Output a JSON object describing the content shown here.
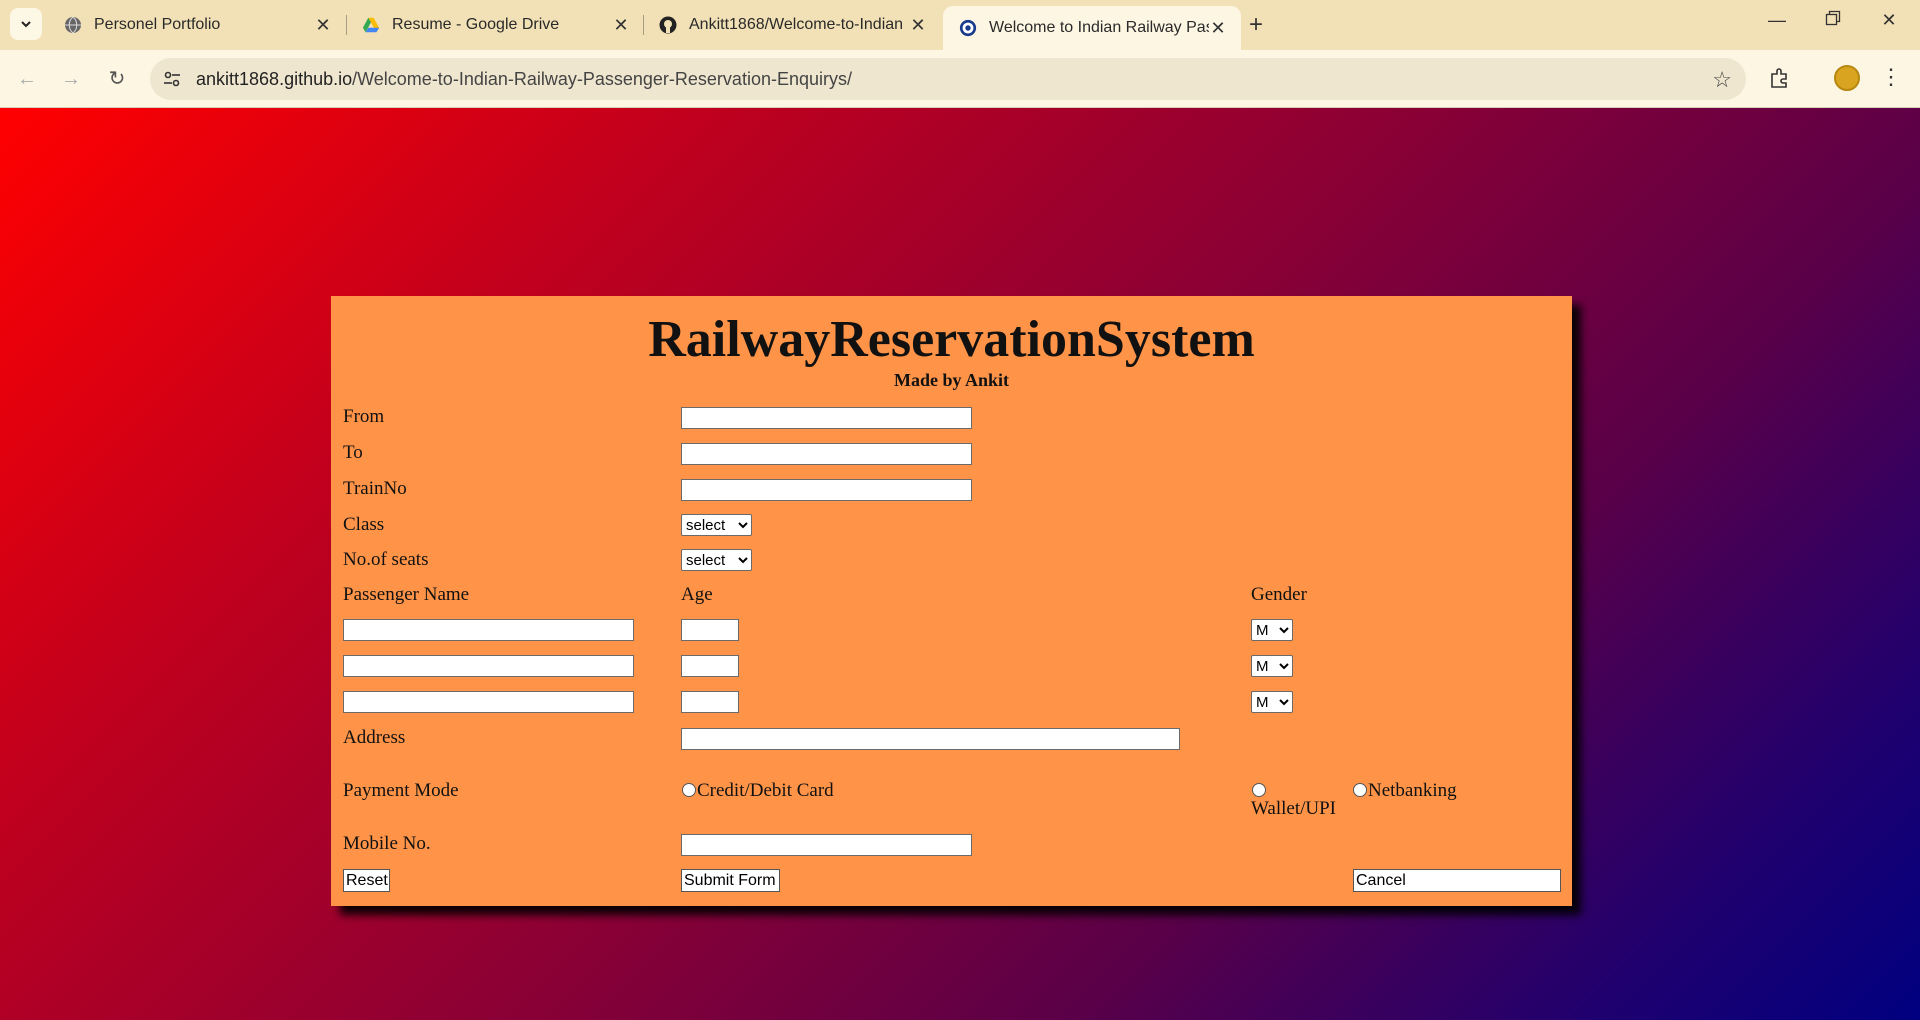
{
  "browser": {
    "tabs": [
      {
        "title": "Personel Portfolio"
      },
      {
        "title": "Resume - Google Drive"
      },
      {
        "title": "Ankitt1868/Welcome-to-Indian"
      },
      {
        "title": "Welcome to Indian Railway Pass"
      }
    ],
    "url_host": "ankitt1868.github.io",
    "url_path": "/Welcome-to-Indian-Railway-Passenger-Reservation-Enquirys/"
  },
  "page": {
    "title": "RailwayReservationSystem",
    "subtitle": "Made by Ankit",
    "labels": {
      "from": "From",
      "to": "To",
      "train_no": "TrainNo",
      "class": "Class",
      "seats": "No.of seats",
      "passenger_name": "Passenger Name",
      "age": "Age",
      "gender": "Gender",
      "address": "Address",
      "payment_mode": "Payment Mode",
      "mobile": "Mobile No."
    },
    "class_select": "select",
    "seats_select": "select",
    "gender_select": "M",
    "payment_options": {
      "card": "Credit/Debit Card",
      "wallet": "Wallet/UPI",
      "netbanking": "Netbanking"
    },
    "buttons": {
      "reset": "Reset",
      "submit": "Submit Form",
      "cancel": "Cancel"
    }
  }
}
